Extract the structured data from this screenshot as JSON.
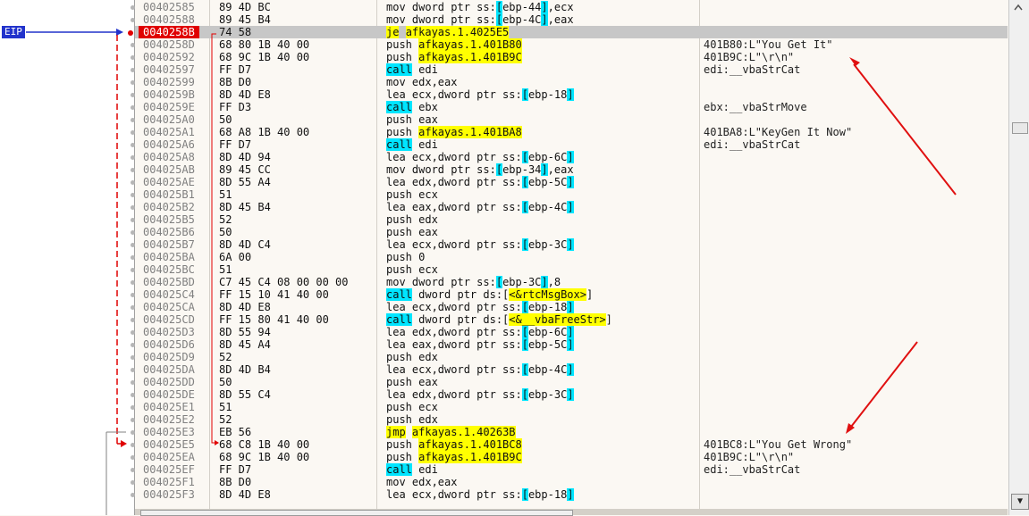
{
  "colors": {
    "eip_badge": "#2233cc",
    "current_address": "#e00000",
    "current_row": "#c7c7c7",
    "operand_highlight": "#ffff00",
    "call_highlight": "#00e5ff",
    "annotation_arrow": "#e01010"
  },
  "eip_badge": "EIP",
  "rows": [
    {
      "addr": "00402585",
      "bytes": "89 4D BC",
      "instr": [
        {
          "t": "mov dword ptr ss:"
        },
        {
          "t": "[",
          "c": "br"
        },
        {
          "t": "ebp-44"
        },
        {
          "t": "]",
          "c": "br"
        },
        {
          "t": ",ecx"
        }
      ],
      "comment": ""
    },
    {
      "addr": "00402588",
      "bytes": "89 45 B4",
      "instr": [
        {
          "t": "mov dword ptr ss:"
        },
        {
          "t": "[",
          "c": "br"
        },
        {
          "t": "ebp-4C"
        },
        {
          "t": "]",
          "c": "br"
        },
        {
          "t": ",eax"
        }
      ],
      "comment": ""
    },
    {
      "addr": "0040258B",
      "bytes": "74 58",
      "instr": [
        {
          "t": "je",
          "c": "ju"
        },
        {
          "t": " "
        },
        {
          "t": "afkayas.1.4025E5",
          "c": "op"
        }
      ],
      "comment": "",
      "current": true
    },
    {
      "addr": "0040258D",
      "bytes": "68 80 1B 40 00",
      "instr": [
        {
          "t": "push "
        },
        {
          "t": "afkayas.1.401B80",
          "c": "op"
        }
      ],
      "comment": "401B80:L\"You Get It\""
    },
    {
      "addr": "00402592",
      "bytes": "68 9C 1B 40 00",
      "instr": [
        {
          "t": "push "
        },
        {
          "t": "afkayas.1.401B9C",
          "c": "op"
        }
      ],
      "comment": "401B9C:L\"\\r\\n\""
    },
    {
      "addr": "00402597",
      "bytes": "FF D7",
      "instr": [
        {
          "t": "call",
          "c": "cl"
        },
        {
          "t": " edi"
        }
      ],
      "comment": "edi:__vbaStrCat"
    },
    {
      "addr": "00402599",
      "bytes": "8B D0",
      "instr": [
        {
          "t": "mov edx,eax"
        }
      ],
      "comment": ""
    },
    {
      "addr": "0040259B",
      "bytes": "8D 4D E8",
      "instr": [
        {
          "t": "lea ecx,dword ptr ss:"
        },
        {
          "t": "[",
          "c": "br"
        },
        {
          "t": "ebp-18"
        },
        {
          "t": "]",
          "c": "br"
        }
      ],
      "comment": ""
    },
    {
      "addr": "0040259E",
      "bytes": "FF D3",
      "instr": [
        {
          "t": "call",
          "c": "cl"
        },
        {
          "t": " ebx"
        }
      ],
      "comment": "ebx:__vbaStrMove"
    },
    {
      "addr": "004025A0",
      "bytes": "50",
      "instr": [
        {
          "t": "push eax"
        }
      ],
      "comment": ""
    },
    {
      "addr": "004025A1",
      "bytes": "68 A8 1B 40 00",
      "instr": [
        {
          "t": "push "
        },
        {
          "t": "afkayas.1.401BA8",
          "c": "op"
        }
      ],
      "comment": "401BA8:L\"KeyGen It Now\""
    },
    {
      "addr": "004025A6",
      "bytes": "FF D7",
      "instr": [
        {
          "t": "call",
          "c": "cl"
        },
        {
          "t": " edi"
        }
      ],
      "comment": "edi:__vbaStrCat"
    },
    {
      "addr": "004025A8",
      "bytes": "8D 4D 94",
      "instr": [
        {
          "t": "lea ecx,dword ptr ss:"
        },
        {
          "t": "[",
          "c": "br"
        },
        {
          "t": "ebp-6C"
        },
        {
          "t": "]",
          "c": "br"
        }
      ],
      "comment": ""
    },
    {
      "addr": "004025AB",
      "bytes": "89 45 CC",
      "instr": [
        {
          "t": "mov dword ptr ss:"
        },
        {
          "t": "[",
          "c": "br"
        },
        {
          "t": "ebp-34"
        },
        {
          "t": "]",
          "c": "br"
        },
        {
          "t": ",eax"
        }
      ],
      "comment": ""
    },
    {
      "addr": "004025AE",
      "bytes": "8D 55 A4",
      "instr": [
        {
          "t": "lea edx,dword ptr ss:"
        },
        {
          "t": "[",
          "c": "br"
        },
        {
          "t": "ebp-5C"
        },
        {
          "t": "]",
          "c": "br"
        }
      ],
      "comment": ""
    },
    {
      "addr": "004025B1",
      "bytes": "51",
      "instr": [
        {
          "t": "push ecx"
        }
      ],
      "comment": ""
    },
    {
      "addr": "004025B2",
      "bytes": "8D 45 B4",
      "instr": [
        {
          "t": "lea eax,dword ptr ss:"
        },
        {
          "t": "[",
          "c": "br"
        },
        {
          "t": "ebp-4C"
        },
        {
          "t": "]",
          "c": "br"
        }
      ],
      "comment": ""
    },
    {
      "addr": "004025B5",
      "bytes": "52",
      "instr": [
        {
          "t": "push edx"
        }
      ],
      "comment": ""
    },
    {
      "addr": "004025B6",
      "bytes": "50",
      "instr": [
        {
          "t": "push eax"
        }
      ],
      "comment": ""
    },
    {
      "addr": "004025B7",
      "bytes": "8D 4D C4",
      "instr": [
        {
          "t": "lea ecx,dword ptr ss:"
        },
        {
          "t": "[",
          "c": "br"
        },
        {
          "t": "ebp-3C"
        },
        {
          "t": "]",
          "c": "br"
        }
      ],
      "comment": ""
    },
    {
      "addr": "004025BA",
      "bytes": "6A 00",
      "instr": [
        {
          "t": "push 0"
        }
      ],
      "comment": ""
    },
    {
      "addr": "004025BC",
      "bytes": "51",
      "instr": [
        {
          "t": "push ecx"
        }
      ],
      "comment": ""
    },
    {
      "addr": "004025BD",
      "bytes": "C7 45 C4 08 00 00 00",
      "instr": [
        {
          "t": "mov dword ptr ss:"
        },
        {
          "t": "[",
          "c": "br"
        },
        {
          "t": "ebp-3C"
        },
        {
          "t": "]",
          "c": "br"
        },
        {
          "t": ",8"
        }
      ],
      "comment": ""
    },
    {
      "addr": "004025C4",
      "bytes": "FF 15 10 41 40 00",
      "instr": [
        {
          "t": "call",
          "c": "cl"
        },
        {
          "t": " dword ptr ds:["
        },
        {
          "t": "<&rtcMsgBox>",
          "c": "op"
        },
        {
          "t": "]"
        }
      ],
      "comment": ""
    },
    {
      "addr": "004025CA",
      "bytes": "8D 4D E8",
      "instr": [
        {
          "t": "lea ecx,dword ptr ss:"
        },
        {
          "t": "[",
          "c": "br"
        },
        {
          "t": "ebp-18"
        },
        {
          "t": "]",
          "c": "br"
        }
      ],
      "comment": ""
    },
    {
      "addr": "004025CD",
      "bytes": "FF 15 80 41 40 00",
      "instr": [
        {
          "t": "call",
          "c": "cl"
        },
        {
          "t": " dword ptr ds:["
        },
        {
          "t": "<&__vbaFreeStr>",
          "c": "op"
        },
        {
          "t": "]"
        }
      ],
      "comment": ""
    },
    {
      "addr": "004025D3",
      "bytes": "8D 55 94",
      "instr": [
        {
          "t": "lea edx,dword ptr ss:"
        },
        {
          "t": "[",
          "c": "br"
        },
        {
          "t": "ebp-6C"
        },
        {
          "t": "]",
          "c": "br"
        }
      ],
      "comment": ""
    },
    {
      "addr": "004025D6",
      "bytes": "8D 45 A4",
      "instr": [
        {
          "t": "lea eax,dword ptr ss:"
        },
        {
          "t": "[",
          "c": "br"
        },
        {
          "t": "ebp-5C"
        },
        {
          "t": "]",
          "c": "br"
        }
      ],
      "comment": ""
    },
    {
      "addr": "004025D9",
      "bytes": "52",
      "instr": [
        {
          "t": "push edx"
        }
      ],
      "comment": ""
    },
    {
      "addr": "004025DA",
      "bytes": "8D 4D B4",
      "instr": [
        {
          "t": "lea ecx,dword ptr ss:"
        },
        {
          "t": "[",
          "c": "br"
        },
        {
          "t": "ebp-4C"
        },
        {
          "t": "]",
          "c": "br"
        }
      ],
      "comment": ""
    },
    {
      "addr": "004025DD",
      "bytes": "50",
      "instr": [
        {
          "t": "push eax"
        }
      ],
      "comment": ""
    },
    {
      "addr": "004025DE",
      "bytes": "8D 55 C4",
      "instr": [
        {
          "t": "lea edx,dword ptr ss:"
        },
        {
          "t": "[",
          "c": "br"
        },
        {
          "t": "ebp-3C"
        },
        {
          "t": "]",
          "c": "br"
        }
      ],
      "comment": ""
    },
    {
      "addr": "004025E1",
      "bytes": "51",
      "instr": [
        {
          "t": "push ecx"
        }
      ],
      "comment": ""
    },
    {
      "addr": "004025E2",
      "bytes": "52",
      "instr": [
        {
          "t": "push edx"
        }
      ],
      "comment": ""
    },
    {
      "addr": "004025E3",
      "bytes": "EB 56",
      "instr": [
        {
          "t": "jmp",
          "c": "ju"
        },
        {
          "t": " "
        },
        {
          "t": "afkayas.1.40263B",
          "c": "op"
        }
      ],
      "comment": ""
    },
    {
      "addr": "004025E5",
      "bytes": "68 C8 1B 40 00",
      "instr": [
        {
          "t": "push "
        },
        {
          "t": "afkayas.1.401BC8",
          "c": "op"
        }
      ],
      "comment": "401BC8:L\"You Get Wrong\""
    },
    {
      "addr": "004025EA",
      "bytes": "68 9C 1B 40 00",
      "instr": [
        {
          "t": "push "
        },
        {
          "t": "afkayas.1.401B9C",
          "c": "op"
        }
      ],
      "comment": "401B9C:L\"\\r\\n\""
    },
    {
      "addr": "004025EF",
      "bytes": "FF D7",
      "instr": [
        {
          "t": "call",
          "c": "cl"
        },
        {
          "t": " edi"
        }
      ],
      "comment": "edi:__vbaStrCat"
    },
    {
      "addr": "004025F1",
      "bytes": "8B D0",
      "instr": [
        {
          "t": "mov edx,eax"
        }
      ],
      "comment": ""
    },
    {
      "addr": "004025F3",
      "bytes": "8D 4D E8",
      "instr": [
        {
          "t": "lea ecx,dword ptr ss:"
        },
        {
          "t": "[",
          "c": "br"
        },
        {
          "t": "ebp-18"
        },
        {
          "t": "]",
          "c": "br"
        }
      ],
      "comment": ""
    }
  ]
}
